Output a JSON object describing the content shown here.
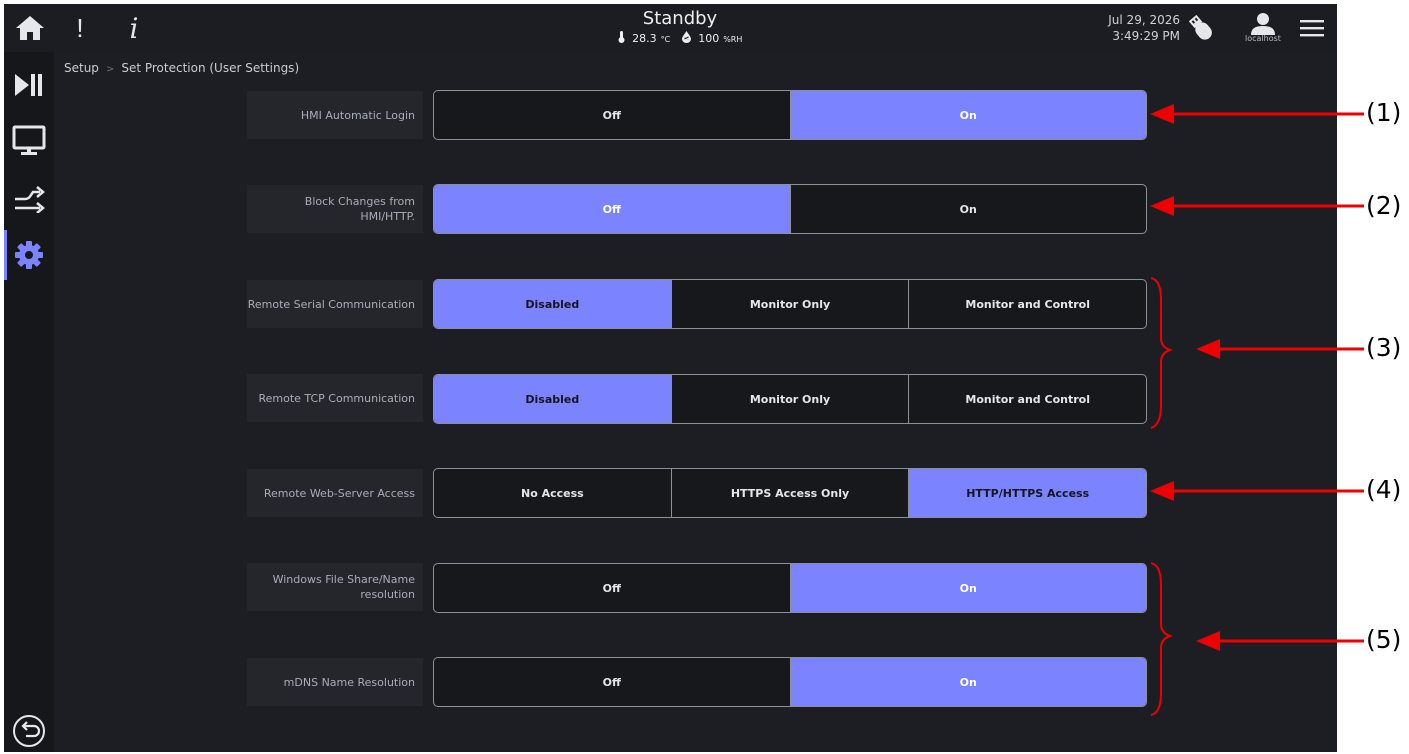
{
  "topbar": {
    "home_icon": "home-icon",
    "alert_glyph": "!",
    "info_glyph": "i",
    "status": "Standby",
    "temperature": "28.3",
    "temperature_unit": "°C",
    "humidity": "100",
    "humidity_unit": "%RH",
    "date": "Jul 29, 2026",
    "time": "3:49:29 PM",
    "user": "localhost"
  },
  "sidebar": {
    "items": [
      {
        "icon": "play-pause-icon"
      },
      {
        "icon": "monitor-icon"
      },
      {
        "icon": "transfer-icon"
      },
      {
        "icon": "gear-icon",
        "active": true
      },
      {
        "icon": "back-icon"
      }
    ],
    "accent": "#7b83ff"
  },
  "breadcrumb": {
    "root": "Setup",
    "current": "Set Protection (User Settings)"
  },
  "settings": [
    {
      "label": "HMI Automatic Login",
      "options": [
        "Off",
        "On"
      ],
      "selected": 1
    },
    {
      "label": "Block Changes from HMI/HTTP.",
      "options": [
        "Off",
        "On"
      ],
      "selected": 0
    },
    {
      "label": "Remote Serial Communication",
      "options": [
        "Disabled",
        "Monitor Only",
        "Monitor and Control"
      ],
      "selected": 0
    },
    {
      "label": "Remote TCP Communication",
      "options": [
        "Disabled",
        "Monitor Only",
        "Monitor and Control"
      ],
      "selected": 0
    },
    {
      "label": "Remote Web-Server Access",
      "options": [
        "No Access",
        "HTTPS Access Only",
        "HTTP/HTTPS Access"
      ],
      "selected": 2
    },
    {
      "label": "Windows File Share/Name resolution",
      "options": [
        "Off",
        "On"
      ],
      "selected": 1
    },
    {
      "label": "mDNS Name Resolution",
      "options": [
        "Off",
        "On"
      ],
      "selected": 1
    }
  ],
  "annotations": [
    "(1)",
    "(2)",
    "(3)",
    "(4)",
    "(5)"
  ],
  "colors": {
    "selected": "#7b83ff",
    "annotation_arrow": "#ee0000",
    "background": "#1c1e23"
  }
}
